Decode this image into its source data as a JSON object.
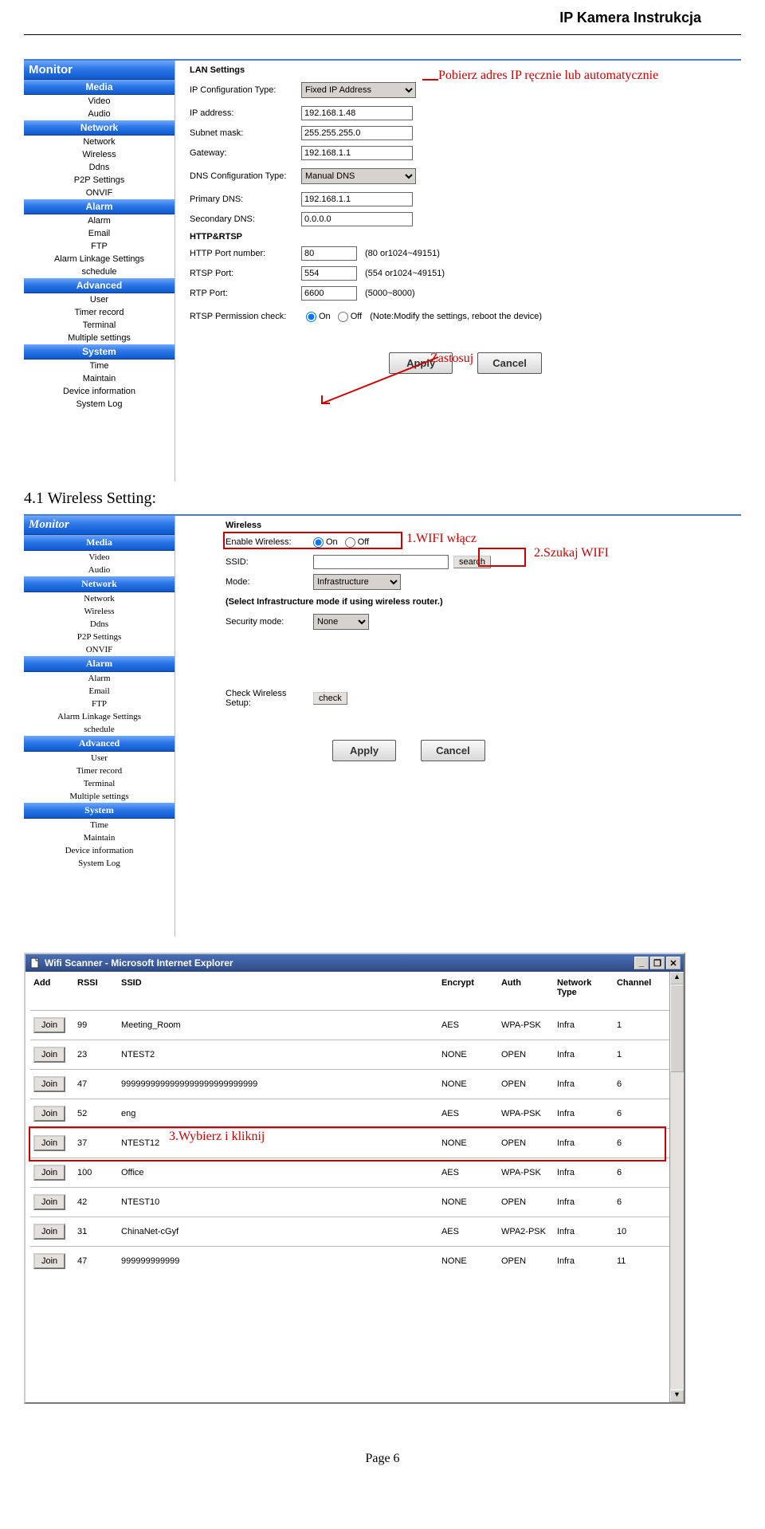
{
  "header_title": "IP Kamera Instrukcja",
  "section_title": "4.1 Wireless Setting:",
  "page_footer": "Page 6",
  "sidebar": {
    "monitor": "Monitor",
    "groups": [
      {
        "head": "Media",
        "items": [
          "Video",
          "Audio"
        ]
      },
      {
        "head": "Network",
        "items": [
          "Network",
          "Wireless",
          "Ddns",
          "P2P Settings",
          "ONVIF"
        ]
      },
      {
        "head": "Alarm",
        "items": [
          "Alarm",
          "Email",
          "FTP",
          "Alarm Linkage Settings",
          "schedule"
        ]
      },
      {
        "head": "Advanced",
        "items": [
          "User",
          "Timer record",
          "Terminal",
          "Multiple settings"
        ]
      },
      {
        "head": "System",
        "items": [
          "Time",
          "Maintain",
          "Device information",
          "System Log"
        ]
      }
    ]
  },
  "lan": {
    "heading": "LAN Settings",
    "ip_config_label": "IP Configuration Type:",
    "ip_config_value": "Fixed IP Address",
    "ip_address_label": "IP address:",
    "ip_address_value": "192.168.1.48",
    "subnet_label": "Subnet mask:",
    "subnet_value": "255.255.255.0",
    "gateway_label": "Gateway:",
    "gateway_value": "192.168.1.1",
    "dns_config_label": "DNS Configuration Type:",
    "dns_config_value": "Manual DNS",
    "primary_dns_label": "Primary DNS:",
    "primary_dns_value": "192.168.1.1",
    "secondary_dns_label": "Secondary DNS:",
    "secondary_dns_value": "0.0.0.0",
    "http_heading": "HTTP&RTSP",
    "http_port_label": "HTTP Port number:",
    "http_port_value": "80",
    "http_port_hint": "(80 or1024~49151)",
    "rtsp_port_label": "RTSP Port:",
    "rtsp_port_value": "554",
    "rtsp_port_hint": "(554 or1024~49151)",
    "rtp_port_label": "RTP Port:",
    "rtp_port_value": "6600",
    "rtp_port_hint": "(5000~8000)",
    "rtsp_perm_label": "RTSP Permission check:",
    "on": "On",
    "off": "Off",
    "rtsp_perm_note": "(Note:Modify the settings, reboot the device)",
    "apply": "Apply",
    "cancel": "Cancel",
    "annot_fixedip": "Pobierz adres IP ręcznie lub automatycznie",
    "annot_apply": "Zastosuj"
  },
  "wireless": {
    "heading": "Wireless",
    "enable_label": "Enable Wireless:",
    "on": "On",
    "off": "Off",
    "ssid_label": "SSID:",
    "ssid_value": "",
    "search": "search",
    "mode_label": "Mode:",
    "mode_value": "Infrastructure",
    "mode_note": "(Select Infrastructure mode if using wireless router.)",
    "security_label": "Security mode:",
    "security_value": "None",
    "check_label": "Check Wireless Setup:",
    "check_btn": "check",
    "apply": "Apply",
    "cancel": "Cancel",
    "annot_enable": "1.WIFI włącz",
    "annot_search": "2.Szukaj WIFI"
  },
  "wifiscanner": {
    "title": "Wifi Scanner - Microsoft Internet Explorer",
    "cols": [
      "Add",
      "RSSI",
      "SSID",
      "Encrypt",
      "Auth",
      "Network Type",
      "Channel"
    ],
    "join": "Join",
    "rows": [
      {
        "rssi": "99",
        "ssid": "Meeting_Room",
        "enc": "AES",
        "auth": "WPA-PSK",
        "nt": "Infra",
        "ch": "1"
      },
      {
        "rssi": "23",
        "ssid": "NTEST2",
        "enc": "NONE",
        "auth": "OPEN",
        "nt": "Infra",
        "ch": "1"
      },
      {
        "rssi": "47",
        "ssid": "9999999999999999999999999999",
        "enc": "NONE",
        "auth": "OPEN",
        "nt": "Infra",
        "ch": "6"
      },
      {
        "rssi": "52",
        "ssid": "eng",
        "enc": "AES",
        "auth": "WPA-PSK",
        "nt": "Infra",
        "ch": "6"
      },
      {
        "rssi": "37",
        "ssid": "NTEST12",
        "enc": "NONE",
        "auth": "OPEN",
        "nt": "Infra",
        "ch": "6"
      },
      {
        "rssi": "100",
        "ssid": "Office",
        "enc": "AES",
        "auth": "WPA-PSK",
        "nt": "Infra",
        "ch": "6"
      },
      {
        "rssi": "42",
        "ssid": "NTEST10",
        "enc": "NONE",
        "auth": "OPEN",
        "nt": "Infra",
        "ch": "6"
      },
      {
        "rssi": "31",
        "ssid": "ChinaNet-cGyf",
        "enc": "AES",
        "auth": "WPA2-PSK",
        "nt": "Infra",
        "ch": "10"
      },
      {
        "rssi": "47",
        "ssid": "999999999999",
        "enc": "NONE",
        "auth": "OPEN",
        "nt": "Infra",
        "ch": "11"
      }
    ],
    "annot_row": "3.Wybierz i kliknij"
  }
}
